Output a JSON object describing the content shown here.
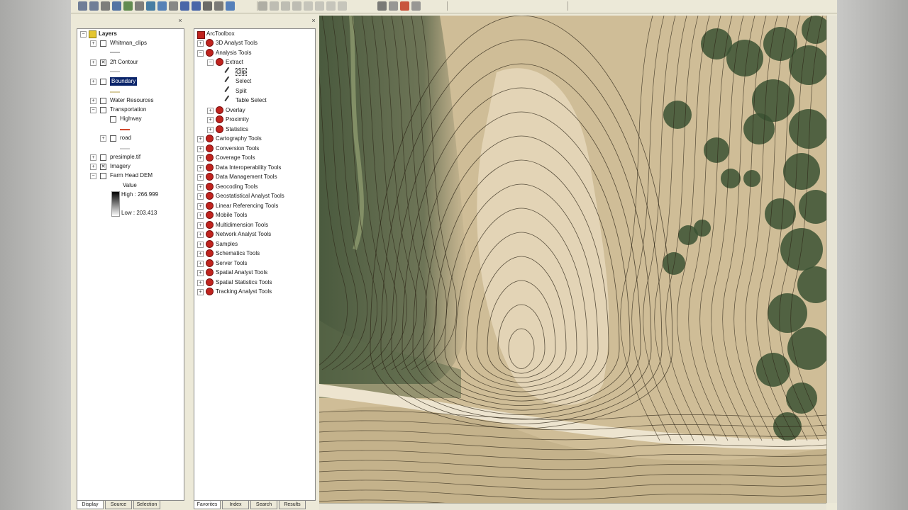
{
  "toc": {
    "root_label": "Layers",
    "layers": [
      {
        "name": "Whitman_clips",
        "checked": false
      },
      {
        "name": "2ft Contour",
        "checked": true
      },
      {
        "name": "Boundary",
        "checked": false,
        "selected": true
      },
      {
        "name": "Water Resources",
        "checked": false
      },
      {
        "name": "Transportation",
        "checked": false
      },
      {
        "name": "Highway",
        "checked": false
      },
      {
        "name": "road",
        "checked": false
      },
      {
        "name": "presimple.tif",
        "checked": false
      },
      {
        "name": "Imagery",
        "checked": true
      },
      {
        "name": "Farm Head DEM",
        "checked": false
      }
    ],
    "legend": {
      "value_label": "Value",
      "high_label": "High : 266.999",
      "low_label": "Low : 203.413"
    },
    "tabs": [
      "Display",
      "Source",
      "Selection"
    ]
  },
  "toolbox": {
    "root_label": "ArcToolbox",
    "items": [
      {
        "label": "3D Analyst Tools",
        "level": 0,
        "expanded": false
      },
      {
        "label": "Analysis Tools",
        "level": 0,
        "expanded": true
      },
      {
        "label": "Extract",
        "level": 1,
        "expanded": true
      },
      {
        "label": "Clip",
        "level": 2,
        "tool": true,
        "selected": true
      },
      {
        "label": "Select",
        "level": 2,
        "tool": true
      },
      {
        "label": "Split",
        "level": 2,
        "tool": true
      },
      {
        "label": "Table Select",
        "level": 2,
        "tool": true
      },
      {
        "label": "Overlay",
        "level": 1,
        "expanded": false
      },
      {
        "label": "Proximity",
        "level": 1,
        "expanded": false
      },
      {
        "label": "Statistics",
        "level": 1,
        "expanded": false
      },
      {
        "label": "Cartography Tools",
        "level": 0
      },
      {
        "label": "Conversion Tools",
        "level": 0
      },
      {
        "label": "Coverage Tools",
        "level": 0
      },
      {
        "label": "Data Interoperability Tools",
        "level": 0
      },
      {
        "label": "Data Management Tools",
        "level": 0
      },
      {
        "label": "Geocoding Tools",
        "level": 0
      },
      {
        "label": "Geostatistical Analyst Tools",
        "level": 0
      },
      {
        "label": "Linear Referencing Tools",
        "level": 0
      },
      {
        "label": "Mobile Tools",
        "level": 0
      },
      {
        "label": "Multidimension Tools",
        "level": 0
      },
      {
        "label": "Network Analyst Tools",
        "level": 0
      },
      {
        "label": "Samples",
        "level": 0
      },
      {
        "label": "Schematics Tools",
        "level": 0
      },
      {
        "label": "Server Tools",
        "level": 0
      },
      {
        "label": "Spatial Analyst Tools",
        "level": 0
      },
      {
        "label": "Spatial Statistics Tools",
        "level": 0
      },
      {
        "label": "Tracking Analyst Tools",
        "level": 0
      }
    ],
    "tabs": [
      "Favorites",
      "Index",
      "Search",
      "Results"
    ]
  },
  "toolbar": {
    "buttons": [
      "zoom-in-icon",
      "zoom-out-icon",
      "pan-icon",
      "full-extent-icon",
      "fixed-zoom-icon",
      "back-icon",
      "globe-icon",
      "layer-icon",
      "select-icon",
      "identify-icon",
      "info-icon",
      "binoculars-icon",
      "measure-icon",
      "hyperlink-icon",
      "route-icon",
      "editor-icon",
      "sketch-icon",
      "edit-icon",
      "vertex-icon",
      "trace-icon",
      "split-icon",
      "rotate-icon",
      "attributes-icon",
      "sketch-props-icon",
      "toolbox-icon",
      "python-icon"
    ]
  },
  "colors": {
    "app_bg": "#ece9d8",
    "selection": "#0a246a",
    "toolbox_red": "#c0231e",
    "contour": "#2c2416"
  }
}
